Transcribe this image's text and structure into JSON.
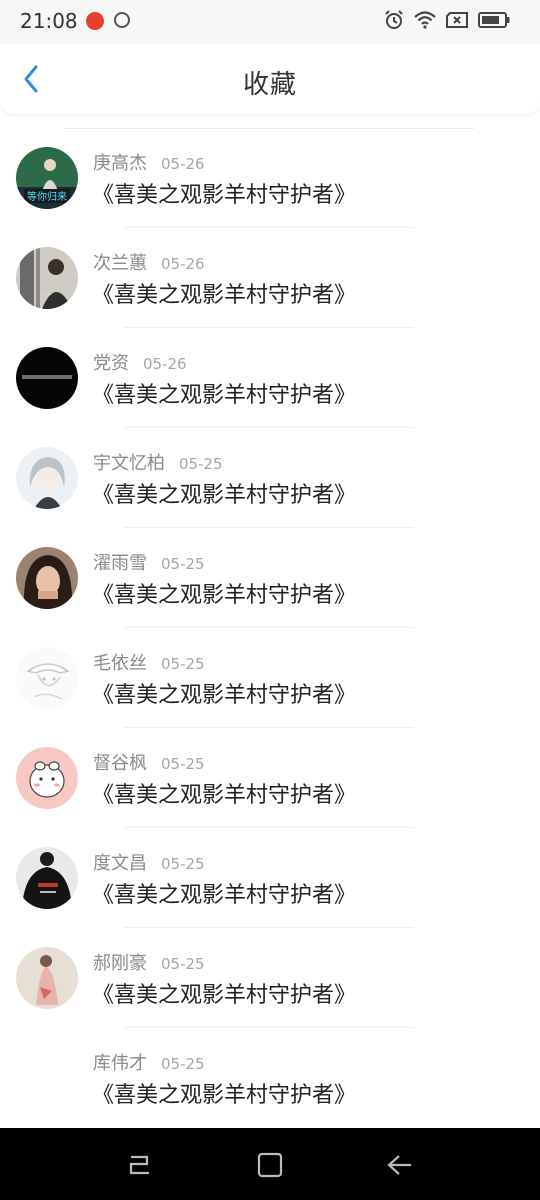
{
  "status_bar": {
    "time": "21:08",
    "left_icons": [
      "app-notification-icon",
      "disc-icon"
    ],
    "right_icons": [
      "alarm-icon",
      "wifi-icon",
      "no-sim-icon",
      "battery-icon"
    ]
  },
  "header": {
    "title": "收藏",
    "back_icon": "chevron-left-icon",
    "accent": "#2a8fe6"
  },
  "items": [
    {
      "name": "庚高杰",
      "date": "05-26",
      "title": "《喜美之观影羊村守护者》",
      "avatar": "photo-girl-caption"
    },
    {
      "name": "次兰蕙",
      "date": "05-26",
      "title": "《喜美之观影羊村守护者》",
      "avatar": "photo-man-window"
    },
    {
      "name": "党资",
      "date": "05-26",
      "title": "《喜美之观影羊村守护者》",
      "avatar": "black-text-circle"
    },
    {
      "name": "宇文忆柏",
      "date": "05-25",
      "title": "《喜美之观影羊村守护者》",
      "avatar": "anime-girl"
    },
    {
      "name": "濯雨雪",
      "date": "05-25",
      "title": "《喜美之观影羊村守护者》",
      "avatar": "photo-girl-face"
    },
    {
      "name": "毛依丝",
      "date": "05-25",
      "title": "《喜美之观影羊村守护者》",
      "avatar": "sketch-hat"
    },
    {
      "name": "督谷枫",
      "date": "05-25",
      "title": "《喜美之观影羊村守护者》",
      "avatar": "pink-sheep-cartoon"
    },
    {
      "name": "度文昌",
      "date": "05-25",
      "title": "《喜美之观影羊村守护者》",
      "avatar": "photo-black-hoodie"
    },
    {
      "name": "郝刚豪",
      "date": "05-25",
      "title": "《喜美之观影羊村守护者》",
      "avatar": "photo-red-dress"
    },
    {
      "name": "库伟才",
      "date": "05-25",
      "title": "《喜美之观影羊村守护者》",
      "avatar": "blank"
    }
  ],
  "nav_bar": {
    "buttons": [
      "recent-apps-icon",
      "home-icon",
      "back-arrow-icon"
    ]
  }
}
